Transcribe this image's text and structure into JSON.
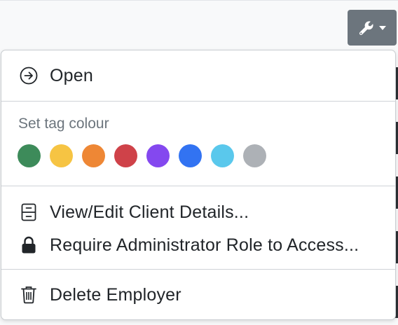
{
  "menu": {
    "open_label": "Open",
    "tag_section_title": "Set tag colour",
    "tag_colors": [
      {
        "name": "green",
        "hex": "#3d8b5a"
      },
      {
        "name": "yellow",
        "hex": "#f6c443"
      },
      {
        "name": "orange",
        "hex": "#ee8735"
      },
      {
        "name": "red",
        "hex": "#cf4249"
      },
      {
        "name": "purple",
        "hex": "#8448ef"
      },
      {
        "name": "blue",
        "hex": "#3273f2"
      },
      {
        "name": "cyan",
        "hex": "#5ac8ec"
      },
      {
        "name": "gray",
        "hex": "#adb1b6"
      }
    ],
    "view_edit_label": "View/Edit Client Details...",
    "require_admin_label": "Require Administrator Role to Access...",
    "delete_label": "Delete Employer"
  },
  "icons": {
    "toolbar": "wrench-icon",
    "toolbar_caret": "caret-down-icon",
    "open": "arrow-circle-right-icon",
    "view_edit": "file-cabinet-icon",
    "require_admin": "lock-icon",
    "delete": "trash-icon"
  },
  "colors": {
    "button_bg": "#6c757d",
    "menu_bg": "#ffffff",
    "muted_text": "#6c757d"
  }
}
